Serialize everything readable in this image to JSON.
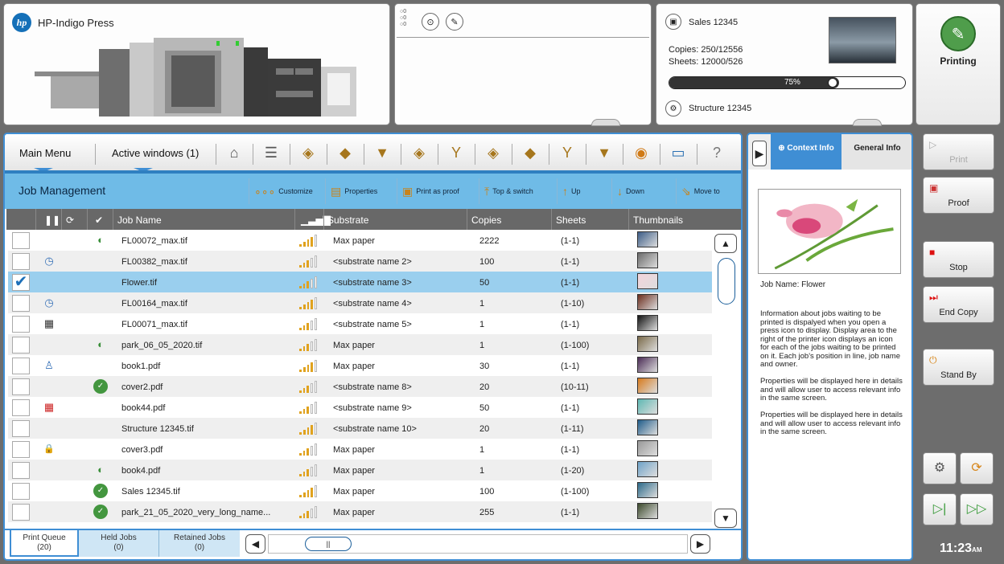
{
  "press": {
    "logo": "hp",
    "name": "HP-Indigo Press"
  },
  "queue_panel": {
    "counts": [
      "0",
      "0",
      "0"
    ]
  },
  "job_panel": {
    "job_name": "Sales 12345",
    "copies": "Copies: 250/12556",
    "sheets": "Sheets: 12000/526",
    "progress_label": "75%",
    "progress": 0.72,
    "structure": "Structure 12345"
  },
  "status": {
    "label": "Printing"
  },
  "toolbar": {
    "main_menu": "Main Menu",
    "active_windows": "Active windows (1)",
    "help": "?"
  },
  "job_management": {
    "title": "Job Management",
    "actions": [
      "Customize",
      "Properties",
      "Print as proof",
      "Top & switch",
      "Up",
      "Down",
      "Move to"
    ]
  },
  "columns": [
    "Job Name",
    "Substrate",
    "Copies",
    "Sheets",
    "Thumbnails"
  ],
  "jobs": [
    {
      "name": "FL00072_max.tif",
      "substrate": "Max paper",
      "copies": "2222",
      "sheets": "(1-1)"
    },
    {
      "name": "FL00382_max.tif",
      "substrate": "<substrate name 2>",
      "copies": "100",
      "sheets": "(1-1)"
    },
    {
      "name": "Flower.tif",
      "substrate": "<substrate name 3>",
      "copies": "50",
      "sheets": "(1-1)"
    },
    {
      "name": "FL00164_max.tif",
      "substrate": "<substrate name 4>",
      "copies": "1",
      "sheets": "(1-10)"
    },
    {
      "name": "FL00071_max.tif",
      "substrate": "<substrate name 5>",
      "copies": "1",
      "sheets": "(1-1)"
    },
    {
      "name": "park_06_05_2020.tif",
      "substrate": "Max paper",
      "copies": "1",
      "sheets": "(1-100)"
    },
    {
      "name": "book1.pdf",
      "substrate": "Max paper",
      "copies": "30",
      "sheets": "(1-1)"
    },
    {
      "name": "cover2.pdf",
      "substrate": "<substrate name 8>",
      "copies": "20",
      "sheets": "(10-11)"
    },
    {
      "name": "book44.pdf",
      "substrate": "<substrate name 9>",
      "copies": "50",
      "sheets": "(1-1)"
    },
    {
      "name": "Structure 12345.tif",
      "substrate": "<substrate name 10>",
      "copies": "20",
      "sheets": "(1-11)"
    },
    {
      "name": "cover3.pdf",
      "substrate": "Max paper",
      "copies": "1",
      "sheets": "(1-1)"
    },
    {
      "name": "book4.pdf",
      "substrate": "Max paper",
      "copies": "1",
      "sheets": "(1-20)"
    },
    {
      "name": "Sales 12345.tif",
      "substrate": "Max paper",
      "copies": "100",
      "sheets": "(1-100)"
    },
    {
      "name": "park_21_05_2020_very_long_name...",
      "substrate": "Max paper",
      "copies": "255",
      "sheets": "(1-1)"
    }
  ],
  "tabs": [
    {
      "label": "Print Queue",
      "count": "(20)"
    },
    {
      "label": "Held Jobs",
      "count": "(0)"
    },
    {
      "label": "Retained Jobs",
      "count": "(0)"
    }
  ],
  "context": {
    "tab_context": "Context Info",
    "tab_general": "General Info",
    "job_name": "Job Name: Flower",
    "paragraphs": [
      "Information about jobs waiting to be printed is dispalyed when you open a press icon to display. Display area to the right of the printer icon displays an icon for each of the jobs waiting to be printed on it. Each job's position in line, job name and owner.",
      "Properties will be displayed here in details and will allow user to access relevant info in the same screen.",
      "Properties will be displayed here in details and will allow user to access relevant info in the same screen."
    ]
  },
  "right_buttons": {
    "print": "Print",
    "proof": "Proof",
    "stop": "Stop",
    "end_copy": "End Copy",
    "stand_by": "Stand By"
  },
  "clock": {
    "time": "11:23",
    "ampm": "AM"
  }
}
